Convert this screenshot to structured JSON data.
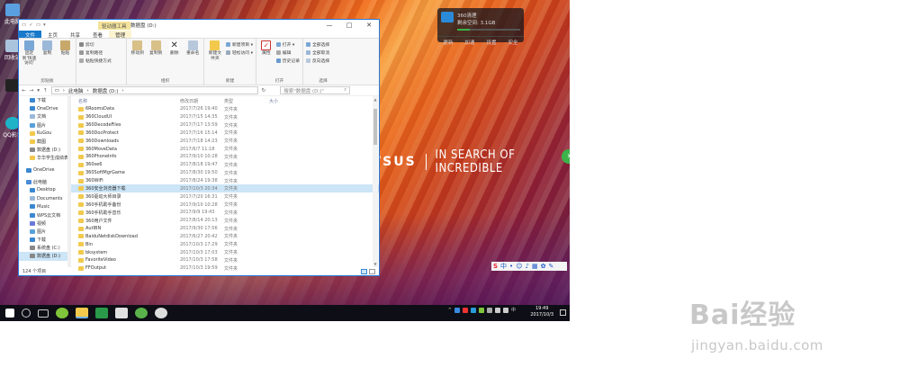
{
  "desktop": {
    "icons": [
      {
        "label": "此电脑"
      },
      {
        "label": "回收站"
      },
      {
        "label": "QQ影音"
      }
    ],
    "asus_brand": "/SUS",
    "asus_slogan": "IN SEARCH OF INCREDIBLE",
    "widget": {
      "title": "360清理",
      "sub": "剩余空间: 3.1GB",
      "items": [
        "更新",
        "加速",
        "设置",
        "安全"
      ]
    }
  },
  "explorer": {
    "title": "数据盘 (D:)",
    "context_tab": "驱动器工具",
    "tabs": [
      "文件",
      "主页",
      "共享",
      "查看",
      "管理"
    ],
    "ribbon": {
      "clipboard": {
        "label": "剪贴板",
        "pin": "固定到'快速访问'",
        "copy": "复制",
        "paste": "粘贴",
        "cut": "剪切",
        "copy_path": "复制路径",
        "paste_shortcut": "粘贴快捷方式"
      },
      "organize": {
        "label": "组织",
        "move_to": "移动到",
        "copy_to": "复制到",
        "delete": "删除",
        "rename": "重命名"
      },
      "new": {
        "label": "新建",
        "new_folder": "新建文件夹",
        "new_item": "新建项目 ▾",
        "easy_access": "轻松访问 ▾"
      },
      "open": {
        "label": "打开",
        "properties": "属性",
        "open": "打开 ▾",
        "edit": "编辑",
        "history": "历史记录"
      },
      "select": {
        "label": "选择",
        "select_all": "全部选择",
        "select_none": "全部取消",
        "invert": "反向选择"
      }
    },
    "address": {
      "path": [
        "此电脑",
        "数据盘 (D:)"
      ],
      "search_placeholder": "搜索\"数据盘 (D:)\""
    },
    "nav": [
      {
        "label": "下载",
        "icon": "download-icon",
        "level": 1
      },
      {
        "label": "OneDrive",
        "icon": "cloud-icon",
        "level": 1
      },
      {
        "label": "文档",
        "icon": "document-icon",
        "level": 1
      },
      {
        "label": "图片",
        "icon": "picture-icon",
        "level": 1
      },
      {
        "label": "KuGou",
        "icon": "folder-icon",
        "level": 1
      },
      {
        "label": "截图",
        "icon": "folder-icon",
        "level": 1
      },
      {
        "label": "数据盘 (D:)",
        "icon": "drive-icon",
        "level": 1
      },
      {
        "label": "华华学生成绩表",
        "icon": "folder-icon",
        "level": 1
      },
      {
        "label": "OneDrive",
        "icon": "cloud-icon",
        "level": 0,
        "gap": true
      },
      {
        "label": "此电脑",
        "icon": "computer-icon",
        "level": 0,
        "gap": true
      },
      {
        "label": "Desktop",
        "icon": "desktop-icon",
        "level": 1
      },
      {
        "label": "Documents",
        "icon": "document-icon",
        "level": 1
      },
      {
        "label": "Music",
        "icon": "music-icon",
        "level": 1
      },
      {
        "label": "WPS云文档",
        "icon": "cloud-icon",
        "level": 1
      },
      {
        "label": "视频",
        "icon": "video-icon",
        "level": 1
      },
      {
        "label": "图片",
        "icon": "picture-icon",
        "level": 1
      },
      {
        "label": "下载",
        "icon": "download-icon",
        "level": 1
      },
      {
        "label": "系统盘 (C:)",
        "icon": "drive-icon",
        "level": 1
      },
      {
        "label": "数据盘 (D:)",
        "icon": "drive-icon",
        "level": 1,
        "selected": true
      }
    ],
    "columns": {
      "name": "名称",
      "date": "修改日期",
      "type": "类型",
      "size": "大小"
    },
    "files": [
      {
        "name": "6RoomsData",
        "date": "2017/7/26 19:40",
        "type": "文件夹"
      },
      {
        "name": "360CloudUI",
        "date": "2017/7/15 14:35",
        "type": "文件夹"
      },
      {
        "name": "360DecodeFiles",
        "date": "2017/7/17 13:59",
        "type": "文件夹"
      },
      {
        "name": "360DocProtect",
        "date": "2017/7/16 15:14",
        "type": "文件夹"
      },
      {
        "name": "360Downloads",
        "date": "2017/7/18 14:23",
        "type": "文件夹"
      },
      {
        "name": "360MoveData",
        "date": "2017/6/7 11:18",
        "type": "文件夹"
      },
      {
        "name": "360PhoneInfo",
        "date": "2017/9/10 10:28",
        "type": "文件夹"
      },
      {
        "name": "360se6",
        "date": "2017/8/18 19:47",
        "type": "文件夹"
      },
      {
        "name": "360SoftMgrGame",
        "date": "2017/8/30 19:50",
        "type": "文件夹"
      },
      {
        "name": "360WiFi",
        "date": "2017/8/24 19:38",
        "type": "文件夹"
      },
      {
        "name": "360安全浏览器下载",
        "date": "2017/10/3 20:34",
        "type": "文件夹",
        "selected": true
      },
      {
        "name": "360驱动大师目录",
        "date": "2017/7/20 16:31",
        "type": "文件夹"
      },
      {
        "name": "360手机助手备份",
        "date": "2017/9/10 10:28",
        "type": "文件夹"
      },
      {
        "name": "360手机助手音乐",
        "date": "2017/9/9 19:43",
        "type": "文件夹"
      },
      {
        "name": "360用户文件",
        "date": "2017/8/14 20:13",
        "type": "文件夹"
      },
      {
        "name": "AutIBN",
        "date": "2017/9/30 17:56",
        "type": "文件夹"
      },
      {
        "name": "BaiduNetdiskDownload",
        "date": "2017/6/27 20:42",
        "type": "文件夹"
      },
      {
        "name": "Bin",
        "date": "2017/10/3 17:29",
        "type": "文件夹"
      },
      {
        "name": "bksystem",
        "date": "2017/10/3 17:03",
        "type": "文件夹"
      },
      {
        "name": "FavoriteVideo",
        "date": "2017/10/3 17:58",
        "type": "文件夹"
      },
      {
        "name": "FFOutput",
        "date": "2017/10/3 19:59",
        "type": "文件夹"
      }
    ],
    "status": "124 个项目"
  },
  "ime_bar": "中",
  "taskbar": {
    "time": "19:49",
    "date": "2017/10/3"
  },
  "watermark": {
    "brand": "Bai经验",
    "url": "jingyan.baidu.com"
  },
  "colors": {
    "accent": "#1979ca",
    "selection": "#cce5f7",
    "folder": "#f2c94c",
    "context_tab": "#f4e39a"
  }
}
